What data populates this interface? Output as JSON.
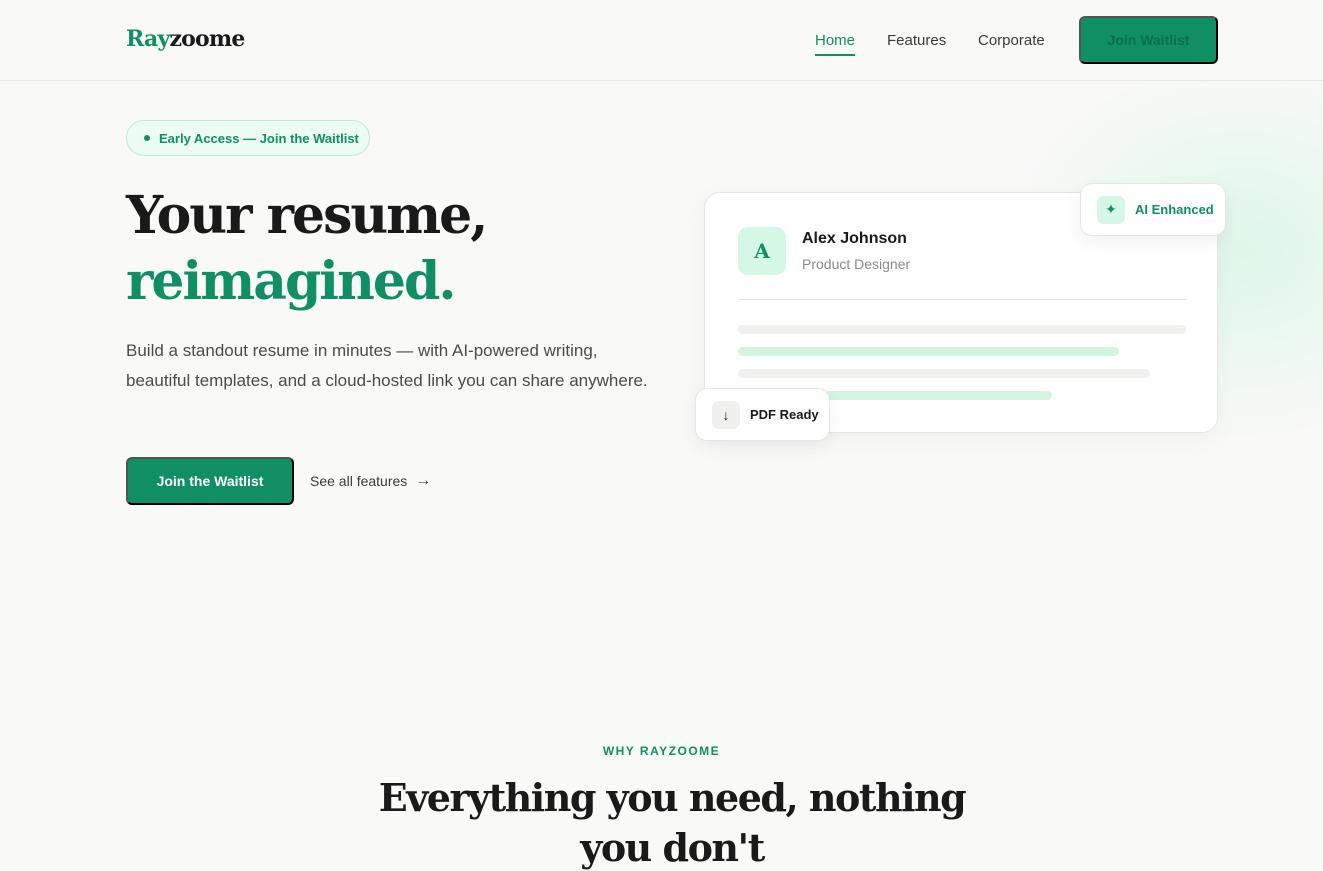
{
  "header": {
    "logo_part1": "Ray",
    "logo_part2": "zoome",
    "nav": [
      {
        "label": "Home",
        "active": true
      },
      {
        "label": "Features",
        "active": false
      },
      {
        "label": "Corporate",
        "active": false
      }
    ],
    "cta_label": "Join Waitlist"
  },
  "hero": {
    "badge": "Early Access — Join the Waitlist",
    "title_line1": "Your resume,",
    "title_line2": "reimagined.",
    "lead": "Build a standout resume in minutes — with AI-powered writing, beautiful templates, and a cloud-hosted link you can share anywhere.",
    "primary_cta": "Join the Waitlist",
    "secondary_cta": "See all features",
    "secondary_arrow": "→"
  },
  "preview": {
    "avatar_letter": "A",
    "name": "Alex Johnson",
    "role": "Product Designer",
    "chip_ai": {
      "icon": "sparkle-icon",
      "label": "AI Enhanced",
      "glyph": "✦"
    },
    "chip_pdf": {
      "icon": "download-arrow-icon",
      "label": "PDF Ready",
      "glyph": "↓"
    }
  },
  "section": {
    "eyebrow": "WHY RAYZOOME",
    "title": "Everything you need, nothing you don't"
  },
  "colors": {
    "brand": "#0f8f63",
    "brand_light": "#d4f7e6",
    "background": "#f9f9f8",
    "text": "#1a1a1a"
  }
}
